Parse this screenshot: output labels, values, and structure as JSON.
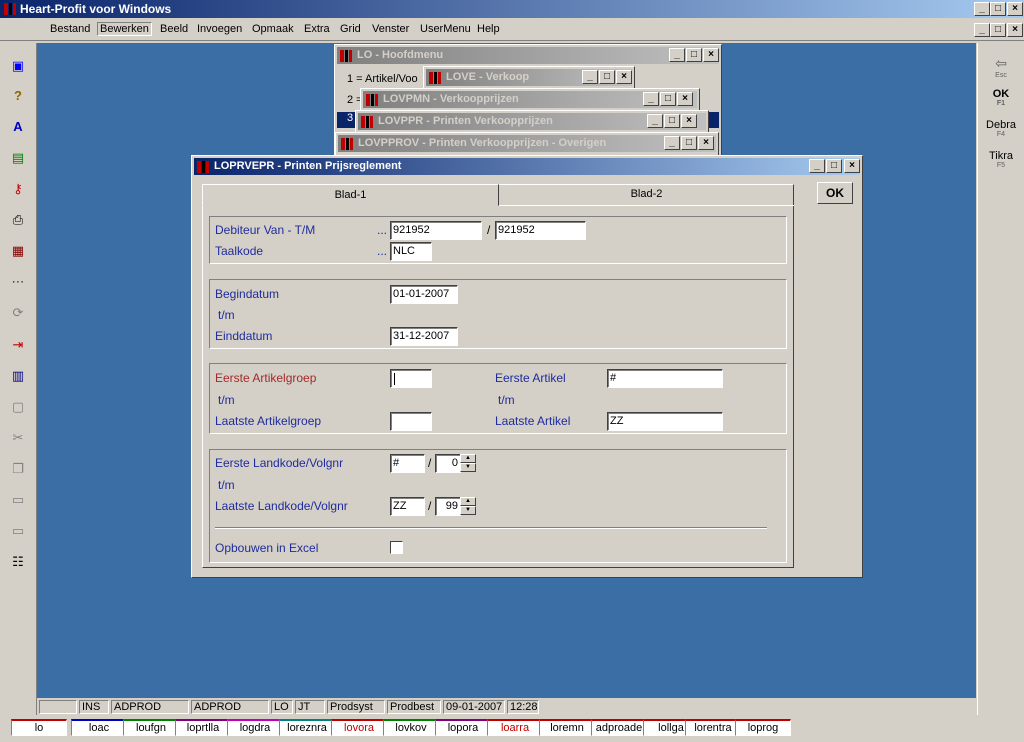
{
  "app": {
    "title": "Heart-Profit voor Windows"
  },
  "menu": [
    "Bestand",
    "Bewerken",
    "Beeld",
    "Invoegen",
    "Opmaak",
    "Extra",
    "Grid",
    "Venster",
    "UserMenu",
    "Help"
  ],
  "caption_buttons": {
    "min": "_",
    "max": "□",
    "close": "×"
  },
  "windows": {
    "hoofdmenu": {
      "title": "LO - Hoofdmenu",
      "line1": "1 = Artikel/Voo",
      "line2": "2 =",
      "line3": "3"
    },
    "verkoop": {
      "title": "LOVE - Verkoop"
    },
    "verkoopprijzen": {
      "title": "LOVPMN - Verkoopprijzen"
    },
    "printen": {
      "title": "LOVPPR - Printen Verkoopprijzen"
    },
    "overigen": {
      "title": "LOVPPROV - Printen Verkoopprijzen - Overigen"
    }
  },
  "dialog": {
    "title": "LOPRVEPR - Printen Prijsreglement",
    "tabs": [
      "Blad-1",
      "Blad-2"
    ],
    "ok_label": "OK",
    "debiteur_label": "Debiteur Van - T/M",
    "debiteur_dots": "...",
    "debiteur_from": "921952",
    "debiteur_to": "921952",
    "taalkode_label": "Taalkode",
    "taalkode_dots": "...",
    "taalkode_value": "NLC",
    "begindatum_label": "Begindatum",
    "tm_label": "t/m",
    "begindatum_value": "01-01-2007",
    "einddatum_label": "Einddatum",
    "einddatum_value": "31-12-2007",
    "eerste_artikelgroep_label": "Eerste  Artikelgroep",
    "eerste_artikelgroep_value": "",
    "laatste_artikelgroep_label": "Laatste Artikelgroep",
    "laatste_artikelgroep_value": "",
    "eerste_artikel_label": "Eerste  Artikel",
    "eerste_artikel_value": "#",
    "laatste_artikel_label": "Laatste Artikel",
    "laatste_artikel_value": "ZZ",
    "eerste_landkode_label": "Eerste  Landkode/Volgnr",
    "eerste_landkode_value": "#",
    "eerste_volgnr_value": "0",
    "laatste_landkode_label": "Laatste Landkode/Volgnr",
    "laatste_landkode_value": "ZZ",
    "laatste_volgnr_value": "99",
    "slash": "/",
    "excel_label": "Opbouwen in Excel"
  },
  "left_toolbar_icons": [
    "app-icon",
    "help-icon",
    "spell-icon",
    "list-icon",
    "key-icon",
    "print-icon",
    "form-icon",
    "dots-icon",
    "refresh-icon",
    "export-icon",
    "grid-icon",
    "window-icon",
    "cut-icon",
    "copy-icon",
    "paste-icon",
    "paste-special-icon",
    "properties-icon"
  ],
  "right_toolbar": [
    {
      "label": "⇦",
      "key": "Esc"
    },
    {
      "label": "OK",
      "key": "F1"
    },
    {
      "label": "Debra",
      "key": "F4"
    },
    {
      "label": "Tikra",
      "key": "F5"
    }
  ],
  "status": [
    "",
    "INS",
    "ADPROD",
    "ADPROD",
    "LO",
    "JT",
    "Prodsyst",
    "Prodbest",
    "09-01-2007",
    "12:28"
  ],
  "taskbar_tabs": [
    {
      "label": "lo",
      "color": "#c00000"
    },
    {
      "label": "loac",
      "color": "#0000c0"
    },
    {
      "label": "loufgn",
      "color": "#008000"
    },
    {
      "label": "loprtlla",
      "color": "#800080"
    },
    {
      "label": "logdra",
      "color": "#c000c0"
    },
    {
      "label": "loreznra",
      "color": "#008080"
    },
    {
      "label": "lovora",
      "color": "#c00000"
    },
    {
      "label": "lovkov",
      "color": "#008000"
    },
    {
      "label": "lopora",
      "color": "#800080"
    },
    {
      "label": "loarra",
      "color": "#c00000"
    },
    {
      "label": "loremn",
      "color": "#c00000"
    },
    {
      "label": "adproade",
      "color": "#c00000"
    },
    {
      "label": "lollga",
      "color": "#c00000"
    },
    {
      "label": "lorentra",
      "color": "#c00000"
    },
    {
      "label": "loprog",
      "color": "#c00000"
    }
  ]
}
